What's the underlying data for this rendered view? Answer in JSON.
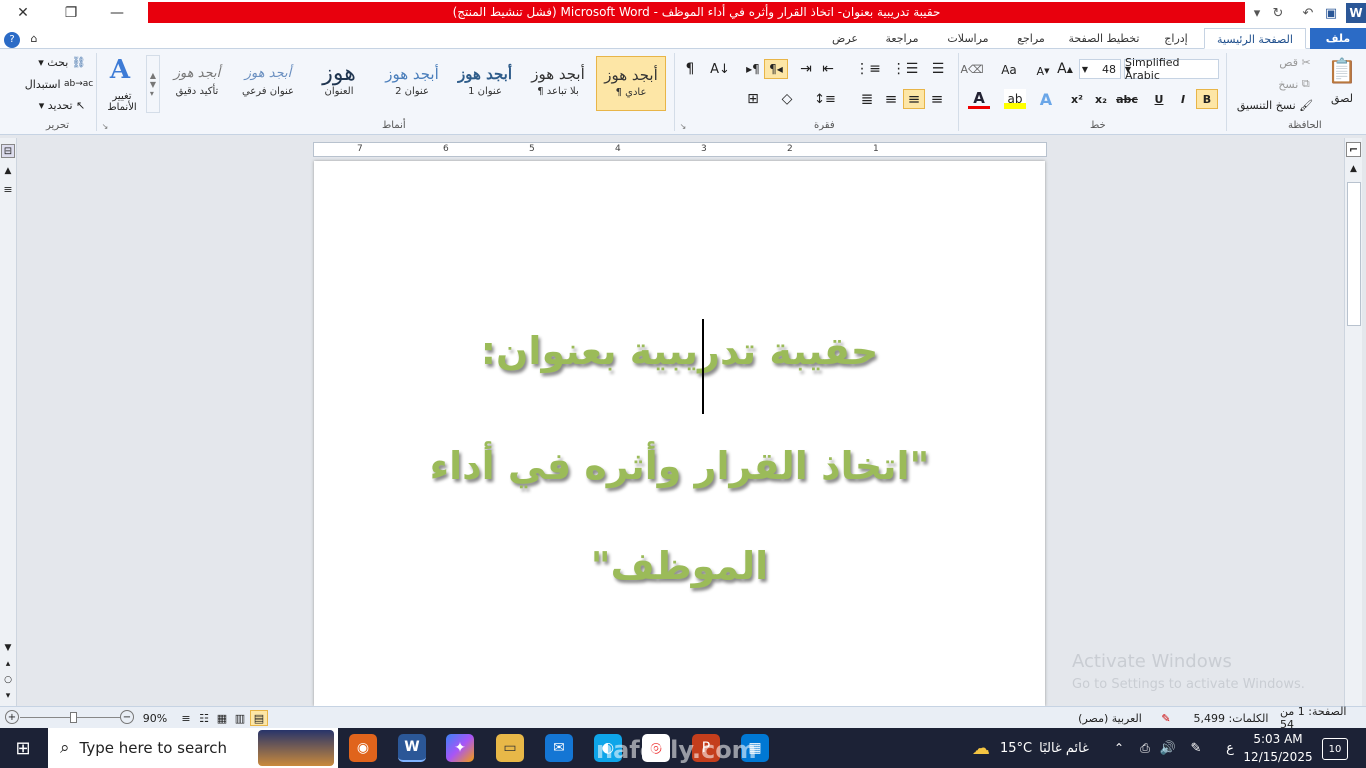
{
  "titlebar": {
    "title": "حقيبة تدريبية بعنوان- اتخاذ القرار وأثره في أداء الموظف  -  Microsoft Word  (فشل تنشيط المنتج)",
    "minimize": "—",
    "maximize": "❐",
    "close": "✕"
  },
  "tabs": {
    "file": "ملف",
    "home": "الصفحة الرئيسية",
    "insert": "إدراج",
    "layout": "تخطيط الصفحة",
    "references": "مراجع",
    "mailings": "مراسلات",
    "review": "مراجعة",
    "view": "عرض"
  },
  "clipboard": {
    "label": "الحافظة",
    "paste": "لصق",
    "cut": "قص",
    "copy": "نسخ",
    "format_painter": "نسخ التنسيق"
  },
  "font": {
    "label": "خط",
    "name": "Simplified Arabic",
    "size": "48",
    "bold": "B",
    "italic": "I",
    "underline": "U",
    "strike": "abc",
    "subscript": "x₂",
    "superscript": "x²",
    "grow": "A",
    "shrink": "A",
    "case": "Aa"
  },
  "paragraph": {
    "label": "فقرة"
  },
  "styles": {
    "label": "أنماط",
    "items": [
      {
        "preview": "أبجد هوز",
        "name": "¶ عادي"
      },
      {
        "preview": "أبجد هوز",
        "name": "¶ بلا تباعد"
      },
      {
        "preview": "أبجد هوز",
        "name": "عنوان 1"
      },
      {
        "preview": "أبجد هوز",
        "name": "عنوان 2"
      },
      {
        "preview": "هوز",
        "name": "العنوان"
      },
      {
        "preview": "أبجد هوز",
        "name": "عنوان فرعي"
      },
      {
        "preview": "أبجد هوز",
        "name": "تأكيد دقيق"
      }
    ],
    "change_styles": "تغيير الأنماط"
  },
  "editing": {
    "label": "تحرير",
    "find": "بحث",
    "replace": "استبدال",
    "select": "تحديد"
  },
  "document": {
    "line1": "حقيبة تدريبية بعنوان:",
    "line2": "\"اتخاذ القرار وأثره في أداء",
    "line3": "الموظف\""
  },
  "ruler": {
    "numbers": [
      "7",
      "6",
      "5",
      "4",
      "3",
      "2",
      "1"
    ]
  },
  "status": {
    "page": "الصفحة: 1 من 54",
    "words": "الكلمات: 5,499",
    "language": "العربية (مصر)",
    "zoom": "90%"
  },
  "activation": {
    "title": "Activate Windows",
    "subtitle": "Go to Settings to activate Windows."
  },
  "taskbar": {
    "search_placeholder": "Type here to search",
    "weather_temp": "15°C",
    "weather_text": "غائم غالبًا",
    "lang": "ع",
    "time": "5:03 AM",
    "date": "12/15/2025",
    "notifications": "10",
    "watermark": "nafozly.com"
  },
  "colors": {
    "title_red": "#e8000d",
    "doc_text": "#9bbb59",
    "file_tab": "#2b6bc6",
    "taskbar": "#1c2236"
  }
}
